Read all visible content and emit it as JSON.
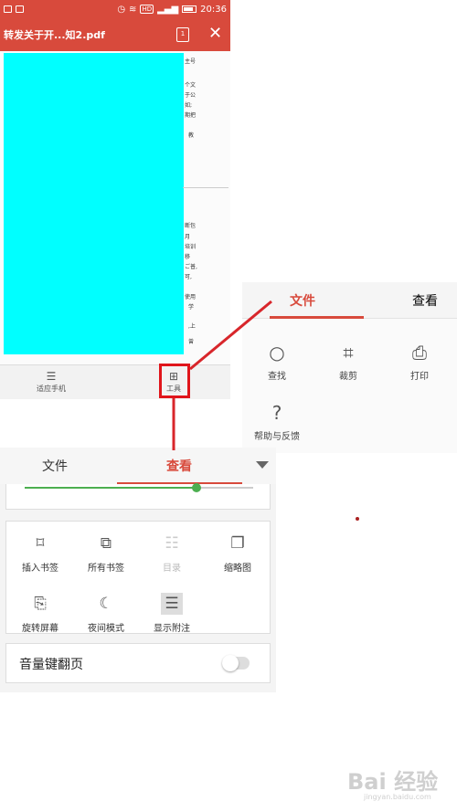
{
  "colors": {
    "accent": "#d84a3c",
    "highlight": "#e0151b",
    "slider": "#4caf50",
    "redacted": "#00ffff"
  },
  "statusbar": {
    "time": "20:36",
    "hd": "HD"
  },
  "titlebar": {
    "doc_title": "转发关于开...知2.pdf",
    "window_icon_label": "1"
  },
  "doc_fragments": [
    "主号",
    "个文",
    "于公",
    "如;",
    "期把",
    "教",
    "断包",
    "月",
    "培训",
    "移",
    "ご普,",
    "可,",
    "使用",
    "学",
    ",上",
    "曾"
  ],
  "bottom_toolbar": {
    "items": [
      {
        "label": "适应手机",
        "icon": "fit-phone-icon"
      },
      {
        "label": "工具",
        "icon": "grid-tools-icon"
      }
    ]
  },
  "right_panel": {
    "tabs": [
      {
        "label": "文件",
        "active": true
      },
      {
        "label": "查看",
        "active": false
      }
    ],
    "items": [
      {
        "label": "查找",
        "icon": "search-icon"
      },
      {
        "label": "裁剪",
        "icon": "crop-icon"
      },
      {
        "label": "打印",
        "icon": "printer-icon"
      },
      {
        "label": "帮助与反馈",
        "icon": "help-icon"
      }
    ]
  },
  "left_panel": {
    "tabs": [
      {
        "label": "文件",
        "active": false
      },
      {
        "label": "查看",
        "active": true
      }
    ],
    "slider_fraction": 0.75,
    "grid_items": [
      {
        "label": "插入书签",
        "icon": "bookmark-icon",
        "enabled": true
      },
      {
        "label": "所有书签",
        "icon": "bookmarks-icon",
        "enabled": true
      },
      {
        "label": "目录",
        "icon": "toc-icon",
        "enabled": false
      },
      {
        "label": "缩略图",
        "icon": "thumbnail-icon",
        "enabled": true
      },
      {
        "label": "旋转屏幕",
        "icon": "rotate-screen-icon",
        "enabled": true
      },
      {
        "label": "夜间模式",
        "icon": "night-mode-icon",
        "enabled": true
      },
      {
        "label": "显示附注",
        "icon": "annotation-icon",
        "enabled": true
      }
    ],
    "volume_key": {
      "label": "音量键翻页",
      "on": false
    }
  },
  "watermark": {
    "text": "Bai 经验",
    "sub": "jingyan.baidu.com"
  }
}
